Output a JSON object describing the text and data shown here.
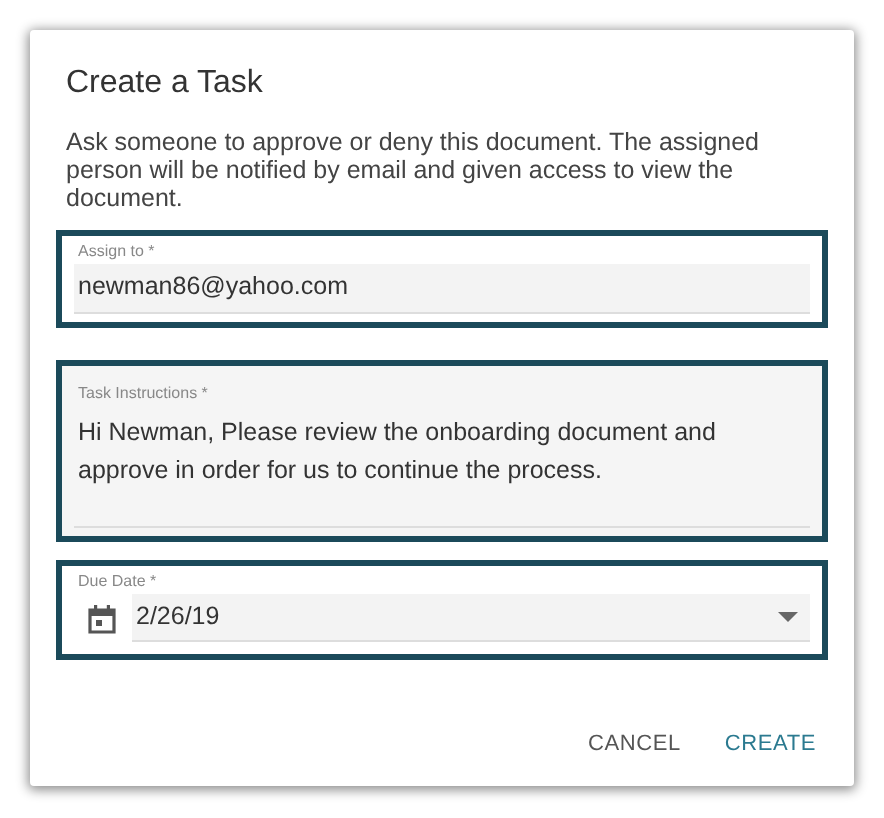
{
  "dialog": {
    "title": "Create a Task",
    "description": "Ask someone to approve or deny this document. The assigned person will be notified by email and given access to view the document."
  },
  "fields": [
    {
      "kind": "text",
      "label": "Assign to *",
      "value": "newman86@yahoo.com",
      "highlighted": true
    },
    {
      "kind": "textarea",
      "label": "Task Instructions *",
      "value": "Hi Newman, Please review the onboarding document and approve in order for us to continue the process.",
      "highlighted": true
    },
    {
      "kind": "date",
      "label": "Due Date *",
      "value": "2/26/19",
      "highlighted": true
    }
  ],
  "buttons": [
    {
      "label": "CANCEL",
      "kind": "secondary"
    },
    {
      "label": "CREATE",
      "kind": "primary"
    }
  ]
}
